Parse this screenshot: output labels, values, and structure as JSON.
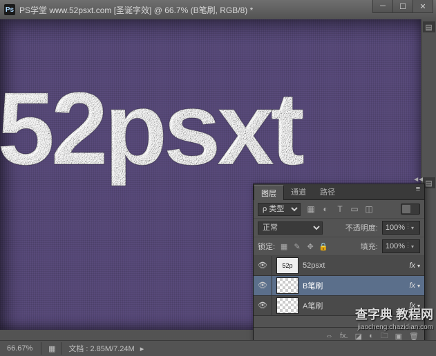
{
  "title": "PS学堂 www.52psxt.com [圣诞字效] @ 66.7% (B笔刷, RGB/8) *",
  "app_icon_label": "Ps",
  "canvas_text": "52psxt",
  "right_collapse_top": "▸▸",
  "right_collapse_bottom": "▸▸",
  "statusbar": {
    "zoom": "66.67%",
    "docsize": "文档 : 2.85M/7.24M"
  },
  "panel": {
    "collapse_indicator": "◄◄",
    "tabs": {
      "layers": "图层",
      "channels": "通道",
      "paths": "路径"
    },
    "filter_label": "ρ 类型",
    "blend_mode": "正常",
    "opacity_label": "不透明度:",
    "opacity_value": "100%",
    "lock_label": "锁定:",
    "fill_label": "填充:",
    "fill_value": "100%",
    "layers": [
      {
        "name": "52psxt",
        "fx": "fx"
      },
      {
        "name": "B笔刷",
        "fx": "fx"
      },
      {
        "name": "A笔刷",
        "fx": "fx"
      }
    ]
  },
  "branding": {
    "big": "查字典 教程网",
    "small": "jiaocheng.chazidian.com"
  }
}
